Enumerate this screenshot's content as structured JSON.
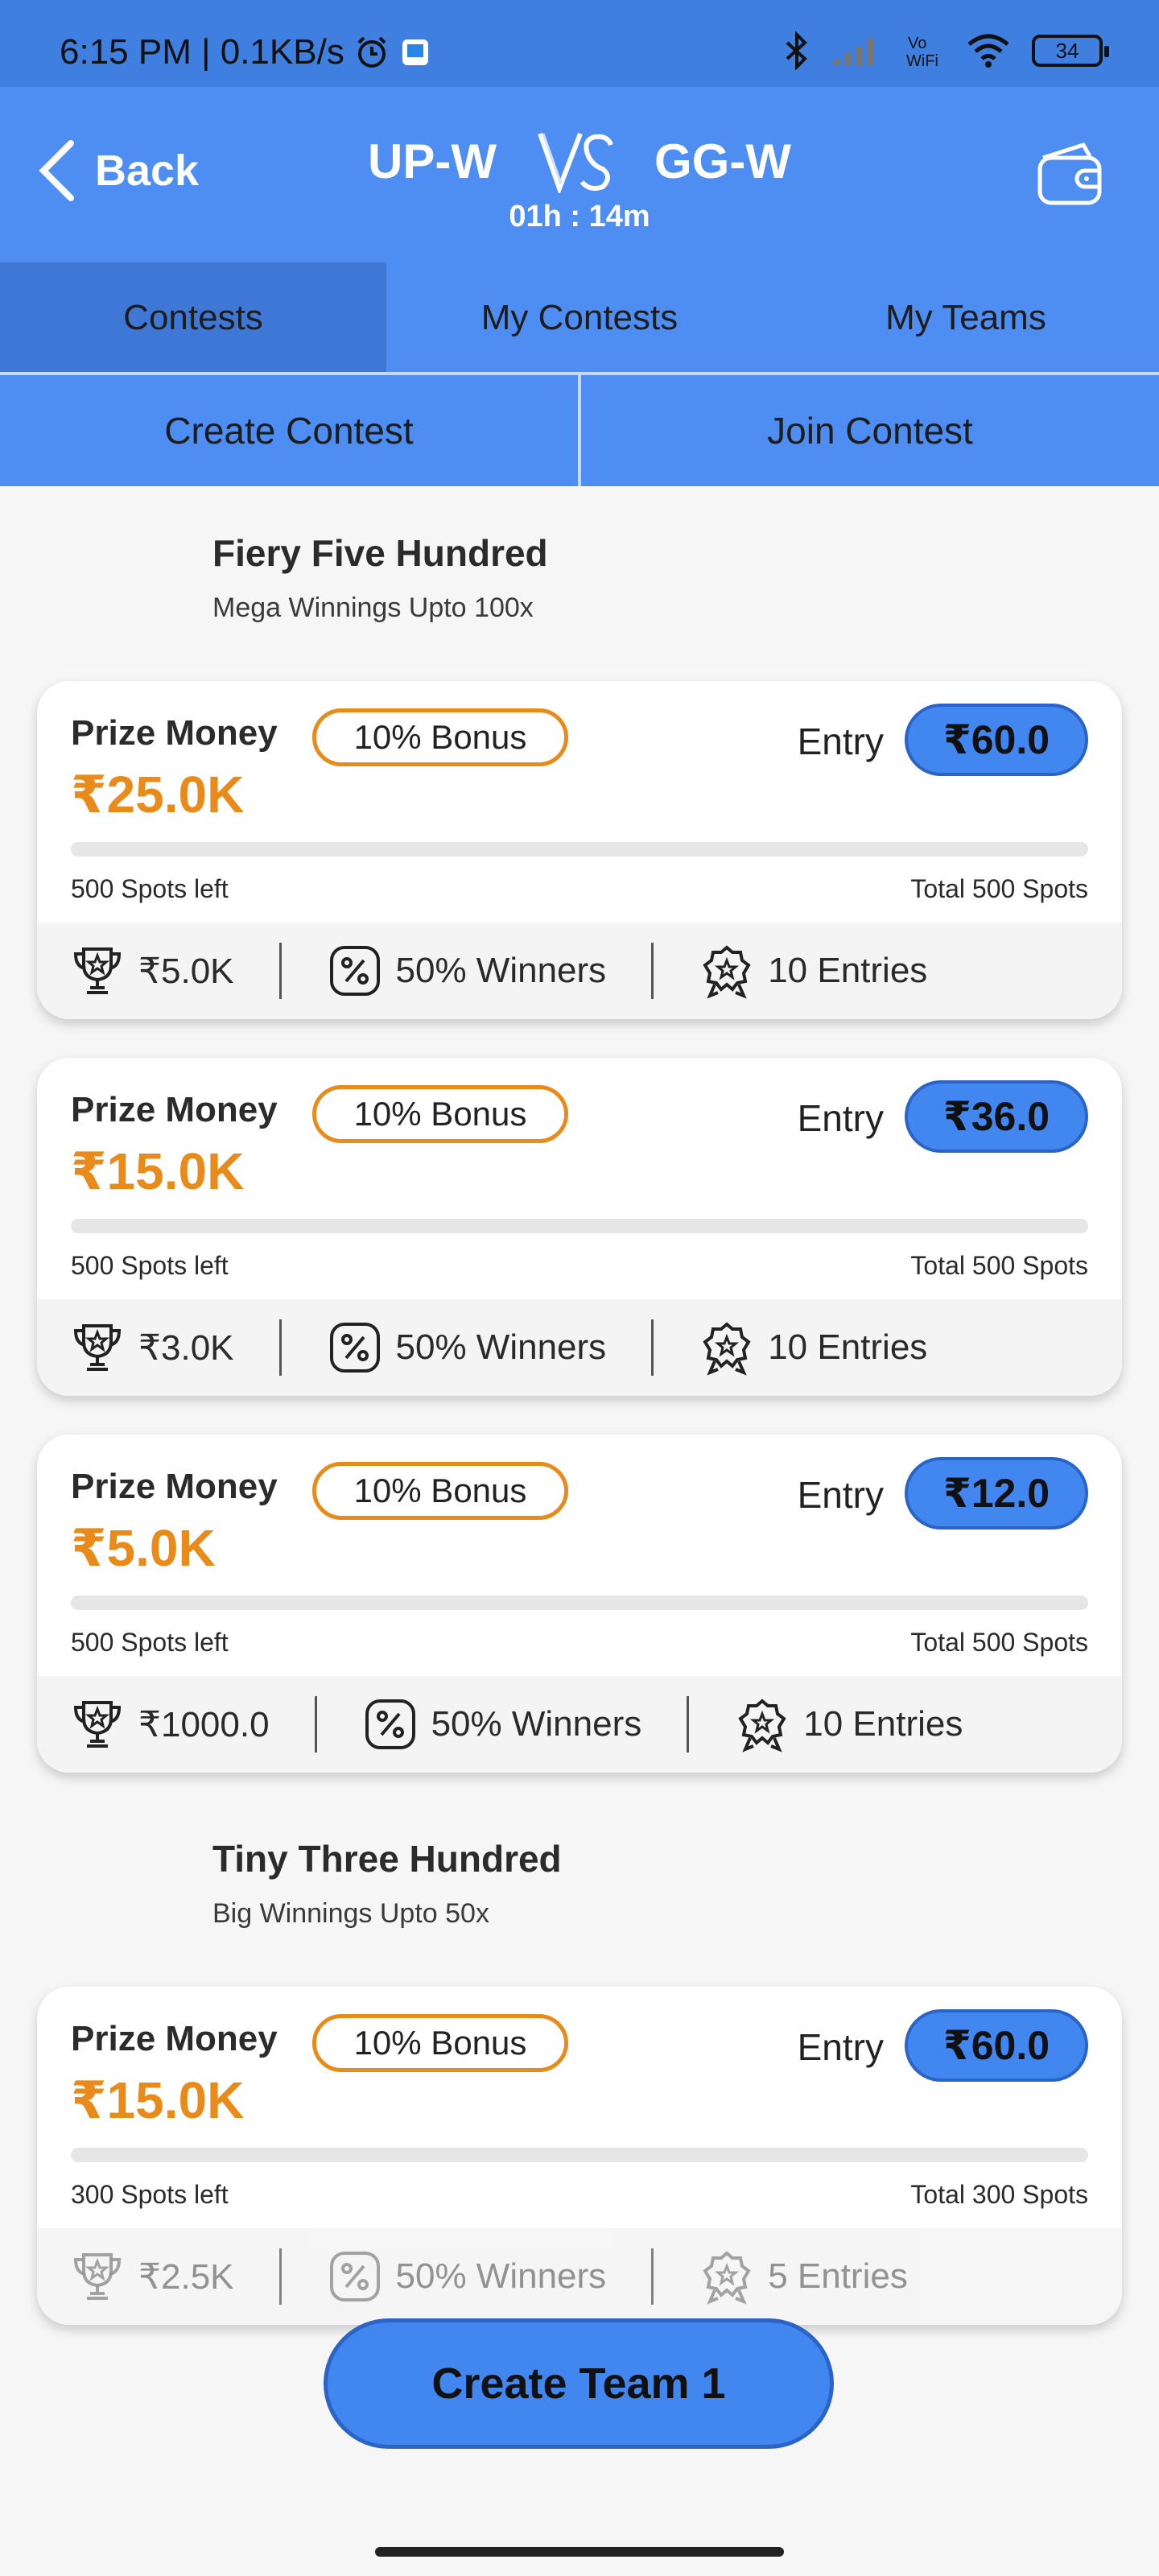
{
  "status_bar": {
    "time_info": "6:15 PM | 0.1KB/s",
    "battery": "34"
  },
  "header": {
    "back_label": "Back",
    "team_home": "UP-W",
    "team_away": "GG-W",
    "timer": "01h : 14m"
  },
  "tabs": [
    {
      "label": "Contests",
      "active": true
    },
    {
      "label": "My Contests",
      "active": false
    },
    {
      "label": "My Teams",
      "active": false
    }
  ],
  "actions": {
    "create": "Create Contest",
    "join": "Join Contest"
  },
  "sections": [
    {
      "title": "Fiery Five Hundred",
      "subtitle": "Mega Winnings Upto 100x",
      "contests": [
        {
          "prize_label": "Prize Money",
          "bonus": "10% Bonus",
          "prize": "₹25.0K",
          "entry_label": "Entry",
          "entry_fee": "₹60.0",
          "spots_left": "500 Spots left",
          "total_spots": "Total 500 Spots",
          "fill_fraction": 0.0,
          "first_prize": "₹5.0K",
          "winners": "50% Winners",
          "entries": "10 Entries"
        },
        {
          "prize_label": "Prize Money",
          "bonus": "10% Bonus",
          "prize": "₹15.0K",
          "entry_label": "Entry",
          "entry_fee": "₹36.0",
          "spots_left": "500 Spots left",
          "total_spots": "Total 500 Spots",
          "fill_fraction": 0.0,
          "first_prize": "₹3.0K",
          "winners": "50% Winners",
          "entries": "10 Entries"
        },
        {
          "prize_label": "Prize Money",
          "bonus": "10% Bonus",
          "prize": "₹5.0K",
          "entry_label": "Entry",
          "entry_fee": "₹12.0",
          "spots_left": "500 Spots left",
          "total_spots": "Total 500 Spots",
          "fill_fraction": 0.0,
          "first_prize": "₹1000.0",
          "winners": "50% Winners",
          "entries": "10 Entries"
        }
      ]
    },
    {
      "title": "Tiny Three Hundred",
      "subtitle": "Big Winnings Upto 50x",
      "contests": [
        {
          "prize_label": "Prize Money",
          "bonus": "10% Bonus",
          "prize": "₹15.0K",
          "entry_label": "Entry",
          "entry_fee": "₹60.0",
          "spots_left": "300 Spots left",
          "total_spots": "Total 300 Spots",
          "fill_fraction": 0.0,
          "first_prize": "₹2.5K",
          "winners": "50% Winners",
          "entries": "5 Entries"
        }
      ]
    }
  ],
  "create_team_label": "Create Team 1",
  "colors": {
    "primary": "#4e8ef2",
    "primary_dark": "#3e77d6",
    "accent_orange": "#e98b1a",
    "entry_button": "#4286ef"
  }
}
